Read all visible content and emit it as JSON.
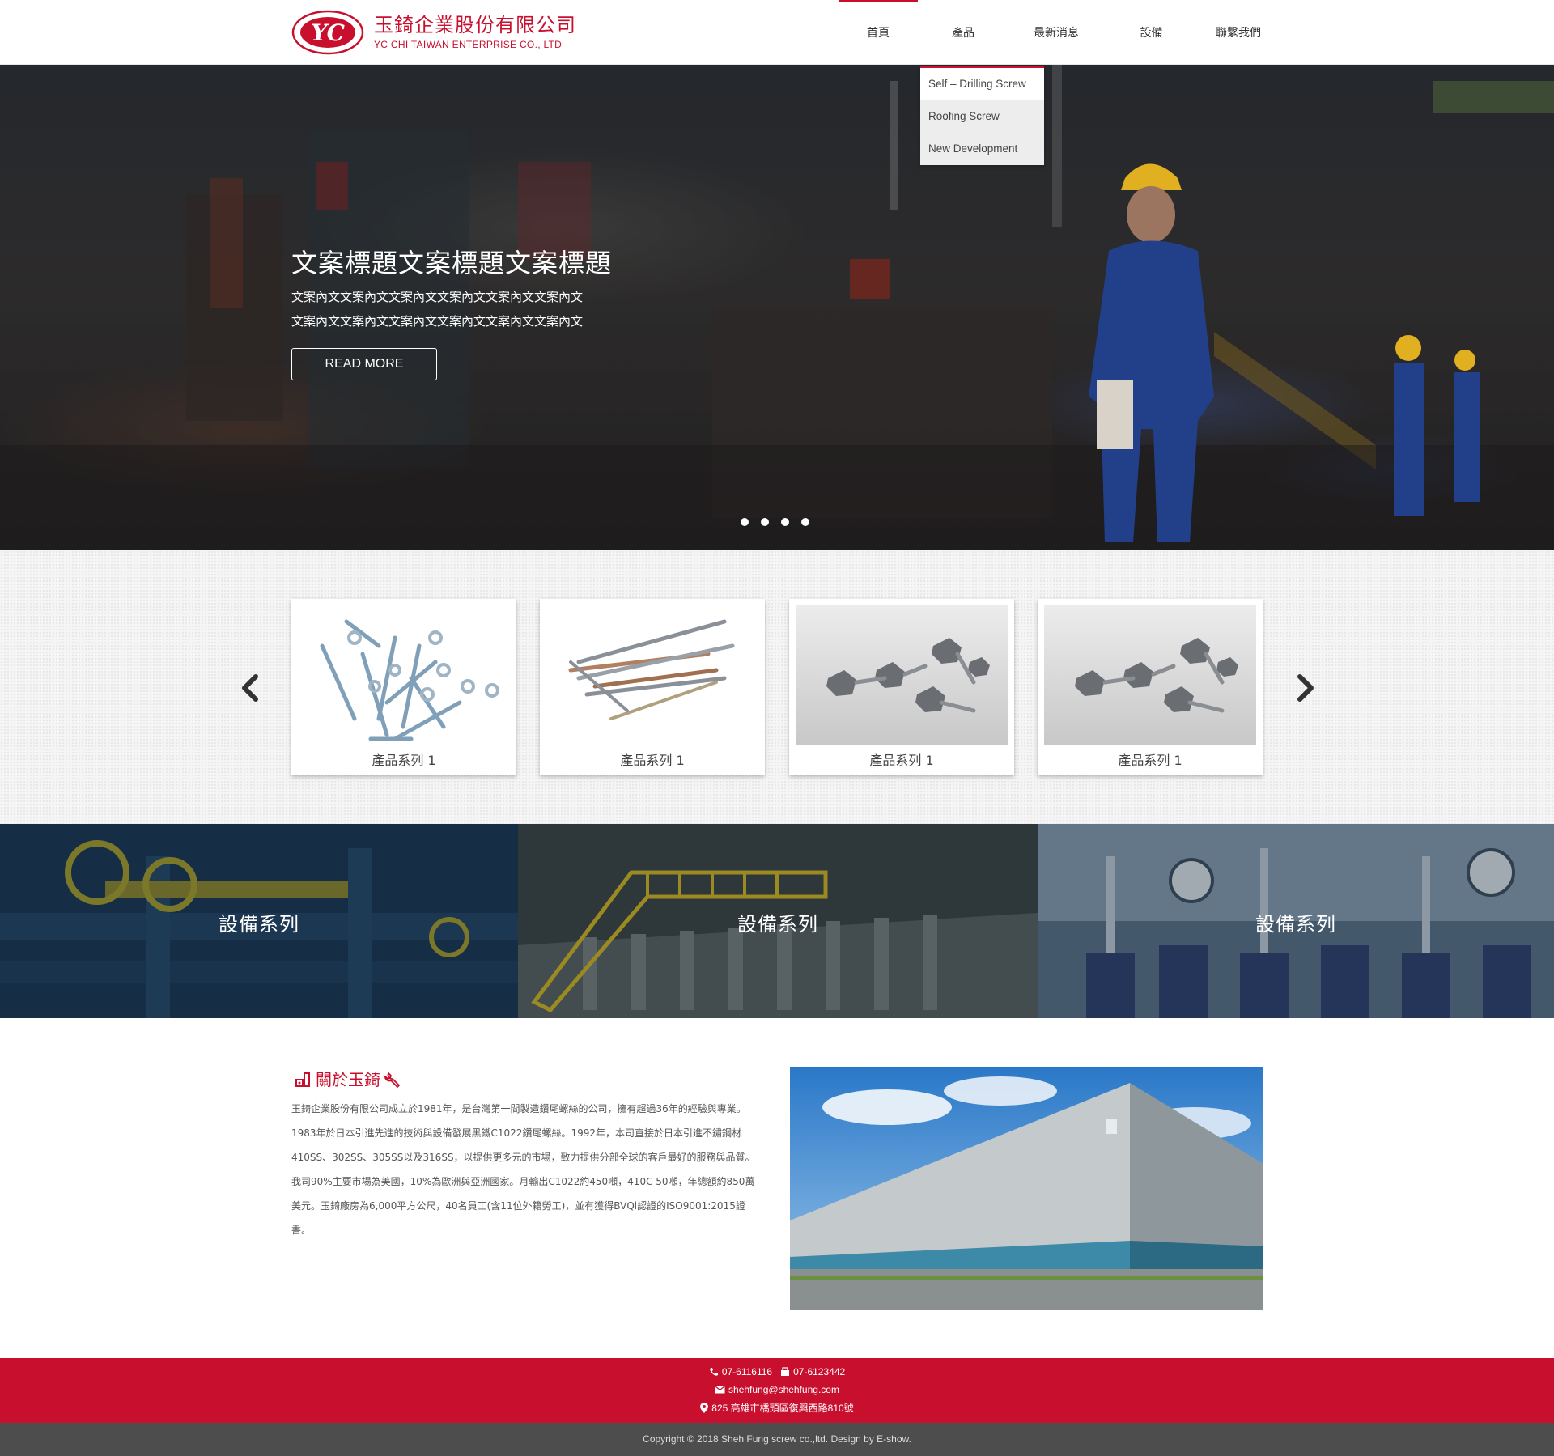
{
  "brand": {
    "name_zh": "玉錡企業股份有限公司",
    "name_en": "YC CHI TAIWAN ENTERPRISE CO., LTD",
    "logo_mark": "YC",
    "color": "#c8102e"
  },
  "nav": {
    "items": [
      {
        "label": "首頁",
        "active": true
      },
      {
        "label": "產品",
        "active": false
      },
      {
        "label": "最新消息",
        "active": false
      },
      {
        "label": "設備",
        "active": false
      },
      {
        "label": "聯繫我們",
        "active": false
      }
    ],
    "dropdown": [
      "Self – Drilling Screw",
      "Roofing Screw",
      "New Development"
    ]
  },
  "hero": {
    "title": "文案標題文案標題文案標題",
    "body_line1": "文案內文文案內文文案內文文案內文文案內文文案內文",
    "body_line2": "文案內文文案內文文案內文文案內文文案內文文案內文",
    "button": "READ MORE",
    "slide_count": 4
  },
  "products": {
    "cards": [
      {
        "label": "產品系列 1",
        "icon": "screws-and-washers-image"
      },
      {
        "label": "產品系列 1",
        "icon": "long-screws-image"
      },
      {
        "label": "產品系列 1",
        "icon": "hex-head-screws-image"
      },
      {
        "label": "產品系列 1",
        "icon": "hex-head-screws-image"
      }
    ],
    "prev_icon": "chevron-left-icon",
    "next_icon": "chevron-right-icon"
  },
  "equipment": {
    "panels": [
      {
        "label": "設備系列"
      },
      {
        "label": "設備系列"
      },
      {
        "label": "設備系列"
      }
    ]
  },
  "about": {
    "title": "關於玉錡",
    "paragraph1": "玉錡企業股份有限公司成立於1981年，是台灣第一間製造鑽尾螺絲的公司，擁有超過36年的經驗與專業。1983年於日本引進先進的技術與設備發展黑鐵C1022鑽尾螺絲。1992年，本司直接於日本引進不鏽鋼材410SS、302SS、305SS以及316SS，以提供更多元的市場，致力提供分部全球的客戶最好的服務與品質。",
    "paragraph2": "我司90%主要市場為美國，10%為歐洲與亞洲國家。月輸出C1022約450噸，410C 50噸，年總額約850萬美元。玉錡廠房為6,000平方公尺，40名員工(含11位外籍勞工)，並有獲得BVQi認證的ISO9001:2015證書。"
  },
  "footer": {
    "phone": "07-6116116",
    "fax": "07-6123442",
    "email": "shehfung@shehfung.com",
    "address": "825 高雄市橋頭區復興西路810號",
    "copyright": "Copyright © 2018 Sheh Fung screw co.,ltd. Design by E-show."
  }
}
